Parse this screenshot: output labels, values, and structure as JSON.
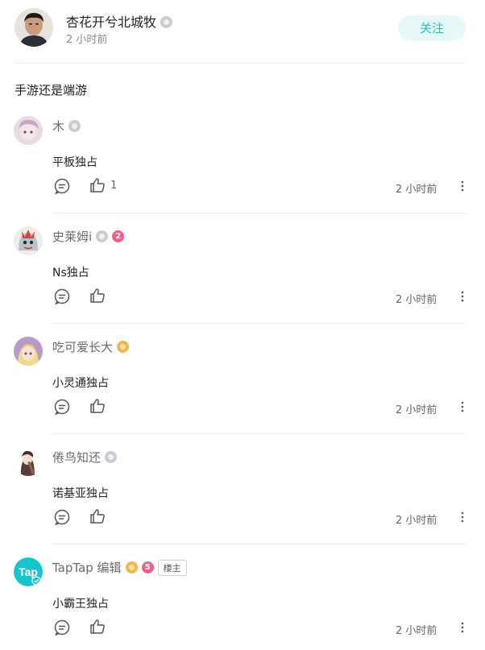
{
  "post": {
    "author": "杏花开兮北城牧",
    "time": "2 小时前",
    "follow_label": "关注",
    "content": "手游还是端游"
  },
  "comments": [
    {
      "name": "木",
      "text": "平板独占",
      "likes": "1",
      "time": "2 小时前",
      "badges": [
        "gray"
      ]
    },
    {
      "name": "史莱姆i",
      "text": "Ns独占",
      "likes": "",
      "time": "2 小时前",
      "badges": [
        "gray",
        "pink"
      ],
      "level": "2"
    },
    {
      "name": "吃可爱长大",
      "text": "小灵通独占",
      "likes": "",
      "time": "2 小时前",
      "badges": [
        "gold"
      ]
    },
    {
      "name": "倦鸟知还",
      "text": "诺基亚独占",
      "likes": "",
      "time": "2 小时前",
      "badges": [
        "gray"
      ]
    },
    {
      "name": "TapTap 编辑",
      "text": "小霸王独占",
      "likes": "",
      "time": "2 小时前",
      "badges": [
        "gold",
        "pink"
      ],
      "level": "5",
      "tag": "楼主"
    }
  ],
  "colors": {
    "accent": "#15c5ce",
    "follow_bg": "#e6f8f7",
    "divider": "#ececec",
    "badge_gold": "#f2b64a",
    "badge_pink": "#ef5f8a"
  },
  "icons": [
    "avatar",
    "verified-badge-icon",
    "reply-icon",
    "thumbs-up-icon",
    "more-vertical-icon",
    "taptap-logo"
  ]
}
